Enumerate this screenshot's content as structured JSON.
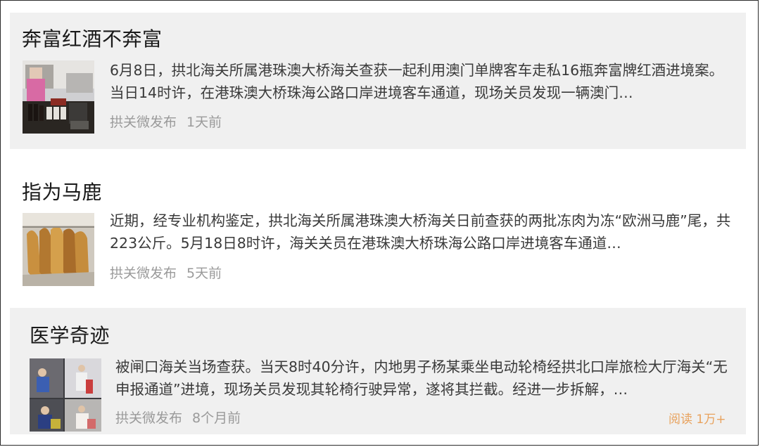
{
  "posts": [
    {
      "title": "奔富红酒不奔富",
      "body": "6月8日，拱北海关所属港珠澳大桥海关查获一起利用澳门单牌客车走私16瓶奔富牌红酒进境案。当日14时许，在港珠澳大桥珠海公路口岸进境客车通道，现场关员发现一辆澳门…",
      "source": "拱关微发布",
      "time": "1天前",
      "thumb_icon": "wine-bottles-photo"
    },
    {
      "title": "指为马鹿",
      "body": "近期，经专业机构鉴定，拱北海关所属港珠澳大桥海关日前查获的两批冻肉为冻“欧洲马鹿”尾，共223公斤。5月18日8时许，海关关员在港珠澳大桥珠海公路口岸进境客车通道…",
      "source": "拱关微发布",
      "time": "5天前",
      "thumb_icon": "deer-tails-photo"
    },
    {
      "title": "医学奇迹",
      "body": "被闸口海关当场查获。当天8时40分许，内地男子杨某乘坐电动轮椅经拱北口岸旅检大厅海关“无申报通道”进境，现场关员发现其轮椅行驶异常，遂将其拦截。经进一步拆解，…",
      "source": "拱关微发布",
      "time": "8个月前",
      "reads": "阅读 1万+",
      "thumb_icon": "surveillance-collage-photo"
    }
  ],
  "colors": {
    "card_shade": "#f0f0f0",
    "reads_accent": "#e8a25d",
    "meta_gray": "#9a9a9a"
  }
}
